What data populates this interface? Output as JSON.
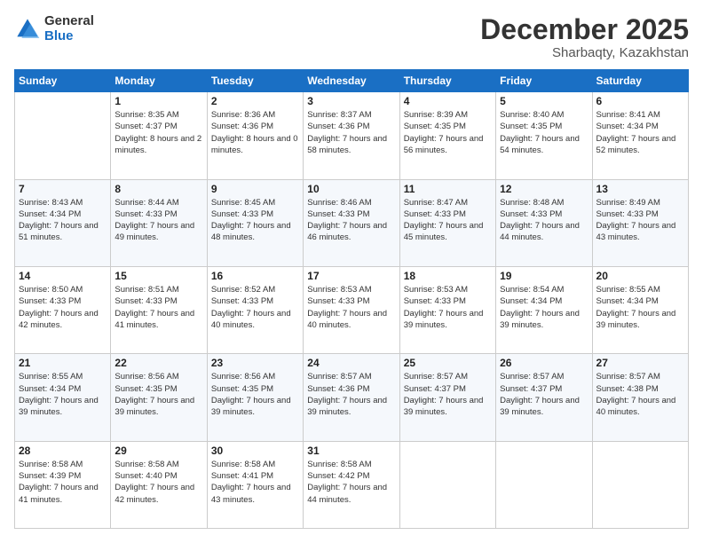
{
  "logo": {
    "general": "General",
    "blue": "Blue"
  },
  "header": {
    "month": "December 2025",
    "location": "Sharbaqty, Kazakhstan"
  },
  "weekdays": [
    "Sunday",
    "Monday",
    "Tuesday",
    "Wednesday",
    "Thursday",
    "Friday",
    "Saturday"
  ],
  "weeks": [
    [
      {
        "day": "",
        "sunrise": "",
        "sunset": "",
        "daylight": ""
      },
      {
        "day": "1",
        "sunrise": "Sunrise: 8:35 AM",
        "sunset": "Sunset: 4:37 PM",
        "daylight": "Daylight: 8 hours and 2 minutes."
      },
      {
        "day": "2",
        "sunrise": "Sunrise: 8:36 AM",
        "sunset": "Sunset: 4:36 PM",
        "daylight": "Daylight: 8 hours and 0 minutes."
      },
      {
        "day": "3",
        "sunrise": "Sunrise: 8:37 AM",
        "sunset": "Sunset: 4:36 PM",
        "daylight": "Daylight: 7 hours and 58 minutes."
      },
      {
        "day": "4",
        "sunrise": "Sunrise: 8:39 AM",
        "sunset": "Sunset: 4:35 PM",
        "daylight": "Daylight: 7 hours and 56 minutes."
      },
      {
        "day": "5",
        "sunrise": "Sunrise: 8:40 AM",
        "sunset": "Sunset: 4:35 PM",
        "daylight": "Daylight: 7 hours and 54 minutes."
      },
      {
        "day": "6",
        "sunrise": "Sunrise: 8:41 AM",
        "sunset": "Sunset: 4:34 PM",
        "daylight": "Daylight: 7 hours and 52 minutes."
      }
    ],
    [
      {
        "day": "7",
        "sunrise": "Sunrise: 8:43 AM",
        "sunset": "Sunset: 4:34 PM",
        "daylight": "Daylight: 7 hours and 51 minutes."
      },
      {
        "day": "8",
        "sunrise": "Sunrise: 8:44 AM",
        "sunset": "Sunset: 4:33 PM",
        "daylight": "Daylight: 7 hours and 49 minutes."
      },
      {
        "day": "9",
        "sunrise": "Sunrise: 8:45 AM",
        "sunset": "Sunset: 4:33 PM",
        "daylight": "Daylight: 7 hours and 48 minutes."
      },
      {
        "day": "10",
        "sunrise": "Sunrise: 8:46 AM",
        "sunset": "Sunset: 4:33 PM",
        "daylight": "Daylight: 7 hours and 46 minutes."
      },
      {
        "day": "11",
        "sunrise": "Sunrise: 8:47 AM",
        "sunset": "Sunset: 4:33 PM",
        "daylight": "Daylight: 7 hours and 45 minutes."
      },
      {
        "day": "12",
        "sunrise": "Sunrise: 8:48 AM",
        "sunset": "Sunset: 4:33 PM",
        "daylight": "Daylight: 7 hours and 44 minutes."
      },
      {
        "day": "13",
        "sunrise": "Sunrise: 8:49 AM",
        "sunset": "Sunset: 4:33 PM",
        "daylight": "Daylight: 7 hours and 43 minutes."
      }
    ],
    [
      {
        "day": "14",
        "sunrise": "Sunrise: 8:50 AM",
        "sunset": "Sunset: 4:33 PM",
        "daylight": "Daylight: 7 hours and 42 minutes."
      },
      {
        "day": "15",
        "sunrise": "Sunrise: 8:51 AM",
        "sunset": "Sunset: 4:33 PM",
        "daylight": "Daylight: 7 hours and 41 minutes."
      },
      {
        "day": "16",
        "sunrise": "Sunrise: 8:52 AM",
        "sunset": "Sunset: 4:33 PM",
        "daylight": "Daylight: 7 hours and 40 minutes."
      },
      {
        "day": "17",
        "sunrise": "Sunrise: 8:53 AM",
        "sunset": "Sunset: 4:33 PM",
        "daylight": "Daylight: 7 hours and 40 minutes."
      },
      {
        "day": "18",
        "sunrise": "Sunrise: 8:53 AM",
        "sunset": "Sunset: 4:33 PM",
        "daylight": "Daylight: 7 hours and 39 minutes."
      },
      {
        "day": "19",
        "sunrise": "Sunrise: 8:54 AM",
        "sunset": "Sunset: 4:34 PM",
        "daylight": "Daylight: 7 hours and 39 minutes."
      },
      {
        "day": "20",
        "sunrise": "Sunrise: 8:55 AM",
        "sunset": "Sunset: 4:34 PM",
        "daylight": "Daylight: 7 hours and 39 minutes."
      }
    ],
    [
      {
        "day": "21",
        "sunrise": "Sunrise: 8:55 AM",
        "sunset": "Sunset: 4:34 PM",
        "daylight": "Daylight: 7 hours and 39 minutes."
      },
      {
        "day": "22",
        "sunrise": "Sunrise: 8:56 AM",
        "sunset": "Sunset: 4:35 PM",
        "daylight": "Daylight: 7 hours and 39 minutes."
      },
      {
        "day": "23",
        "sunrise": "Sunrise: 8:56 AM",
        "sunset": "Sunset: 4:35 PM",
        "daylight": "Daylight: 7 hours and 39 minutes."
      },
      {
        "day": "24",
        "sunrise": "Sunrise: 8:57 AM",
        "sunset": "Sunset: 4:36 PM",
        "daylight": "Daylight: 7 hours and 39 minutes."
      },
      {
        "day": "25",
        "sunrise": "Sunrise: 8:57 AM",
        "sunset": "Sunset: 4:37 PM",
        "daylight": "Daylight: 7 hours and 39 minutes."
      },
      {
        "day": "26",
        "sunrise": "Sunrise: 8:57 AM",
        "sunset": "Sunset: 4:37 PM",
        "daylight": "Daylight: 7 hours and 39 minutes."
      },
      {
        "day": "27",
        "sunrise": "Sunrise: 8:57 AM",
        "sunset": "Sunset: 4:38 PM",
        "daylight": "Daylight: 7 hours and 40 minutes."
      }
    ],
    [
      {
        "day": "28",
        "sunrise": "Sunrise: 8:58 AM",
        "sunset": "Sunset: 4:39 PM",
        "daylight": "Daylight: 7 hours and 41 minutes."
      },
      {
        "day": "29",
        "sunrise": "Sunrise: 8:58 AM",
        "sunset": "Sunset: 4:40 PM",
        "daylight": "Daylight: 7 hours and 42 minutes."
      },
      {
        "day": "30",
        "sunrise": "Sunrise: 8:58 AM",
        "sunset": "Sunset: 4:41 PM",
        "daylight": "Daylight: 7 hours and 43 minutes."
      },
      {
        "day": "31",
        "sunrise": "Sunrise: 8:58 AM",
        "sunset": "Sunset: 4:42 PM",
        "daylight": "Daylight: 7 hours and 44 minutes."
      },
      {
        "day": "",
        "sunrise": "",
        "sunset": "",
        "daylight": ""
      },
      {
        "day": "",
        "sunrise": "",
        "sunset": "",
        "daylight": ""
      },
      {
        "day": "",
        "sunrise": "",
        "sunset": "",
        "daylight": ""
      }
    ]
  ]
}
